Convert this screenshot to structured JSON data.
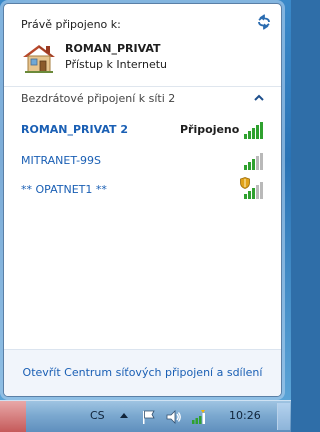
{
  "header": {
    "title": "Právě připojeno k:",
    "connection_name": "ROMAN_PRIVAT",
    "connection_status": "Přístup k Internetu"
  },
  "section": {
    "label": "Bezdrátové připojení k síti 2"
  },
  "networks": [
    {
      "name": "ROMAN_PRIVAT 2",
      "status": "Připojeno",
      "signal_bars": 5,
      "secured": false
    },
    {
      "name": "MITRANET-99S",
      "status": "",
      "signal_bars": 3,
      "secured": false
    },
    {
      "name": "** OPATNET1 **",
      "status": "",
      "signal_bars": 3,
      "secured": true
    }
  ],
  "footer": {
    "link": "Otevřít Centrum síťových připojení a sdílení"
  },
  "taskbar": {
    "language": "CS",
    "clock": "10:26"
  },
  "colors": {
    "link": "#1a5fb4",
    "signal_active": "#2fa12f",
    "signal_inactive": "#b9b9b9"
  }
}
